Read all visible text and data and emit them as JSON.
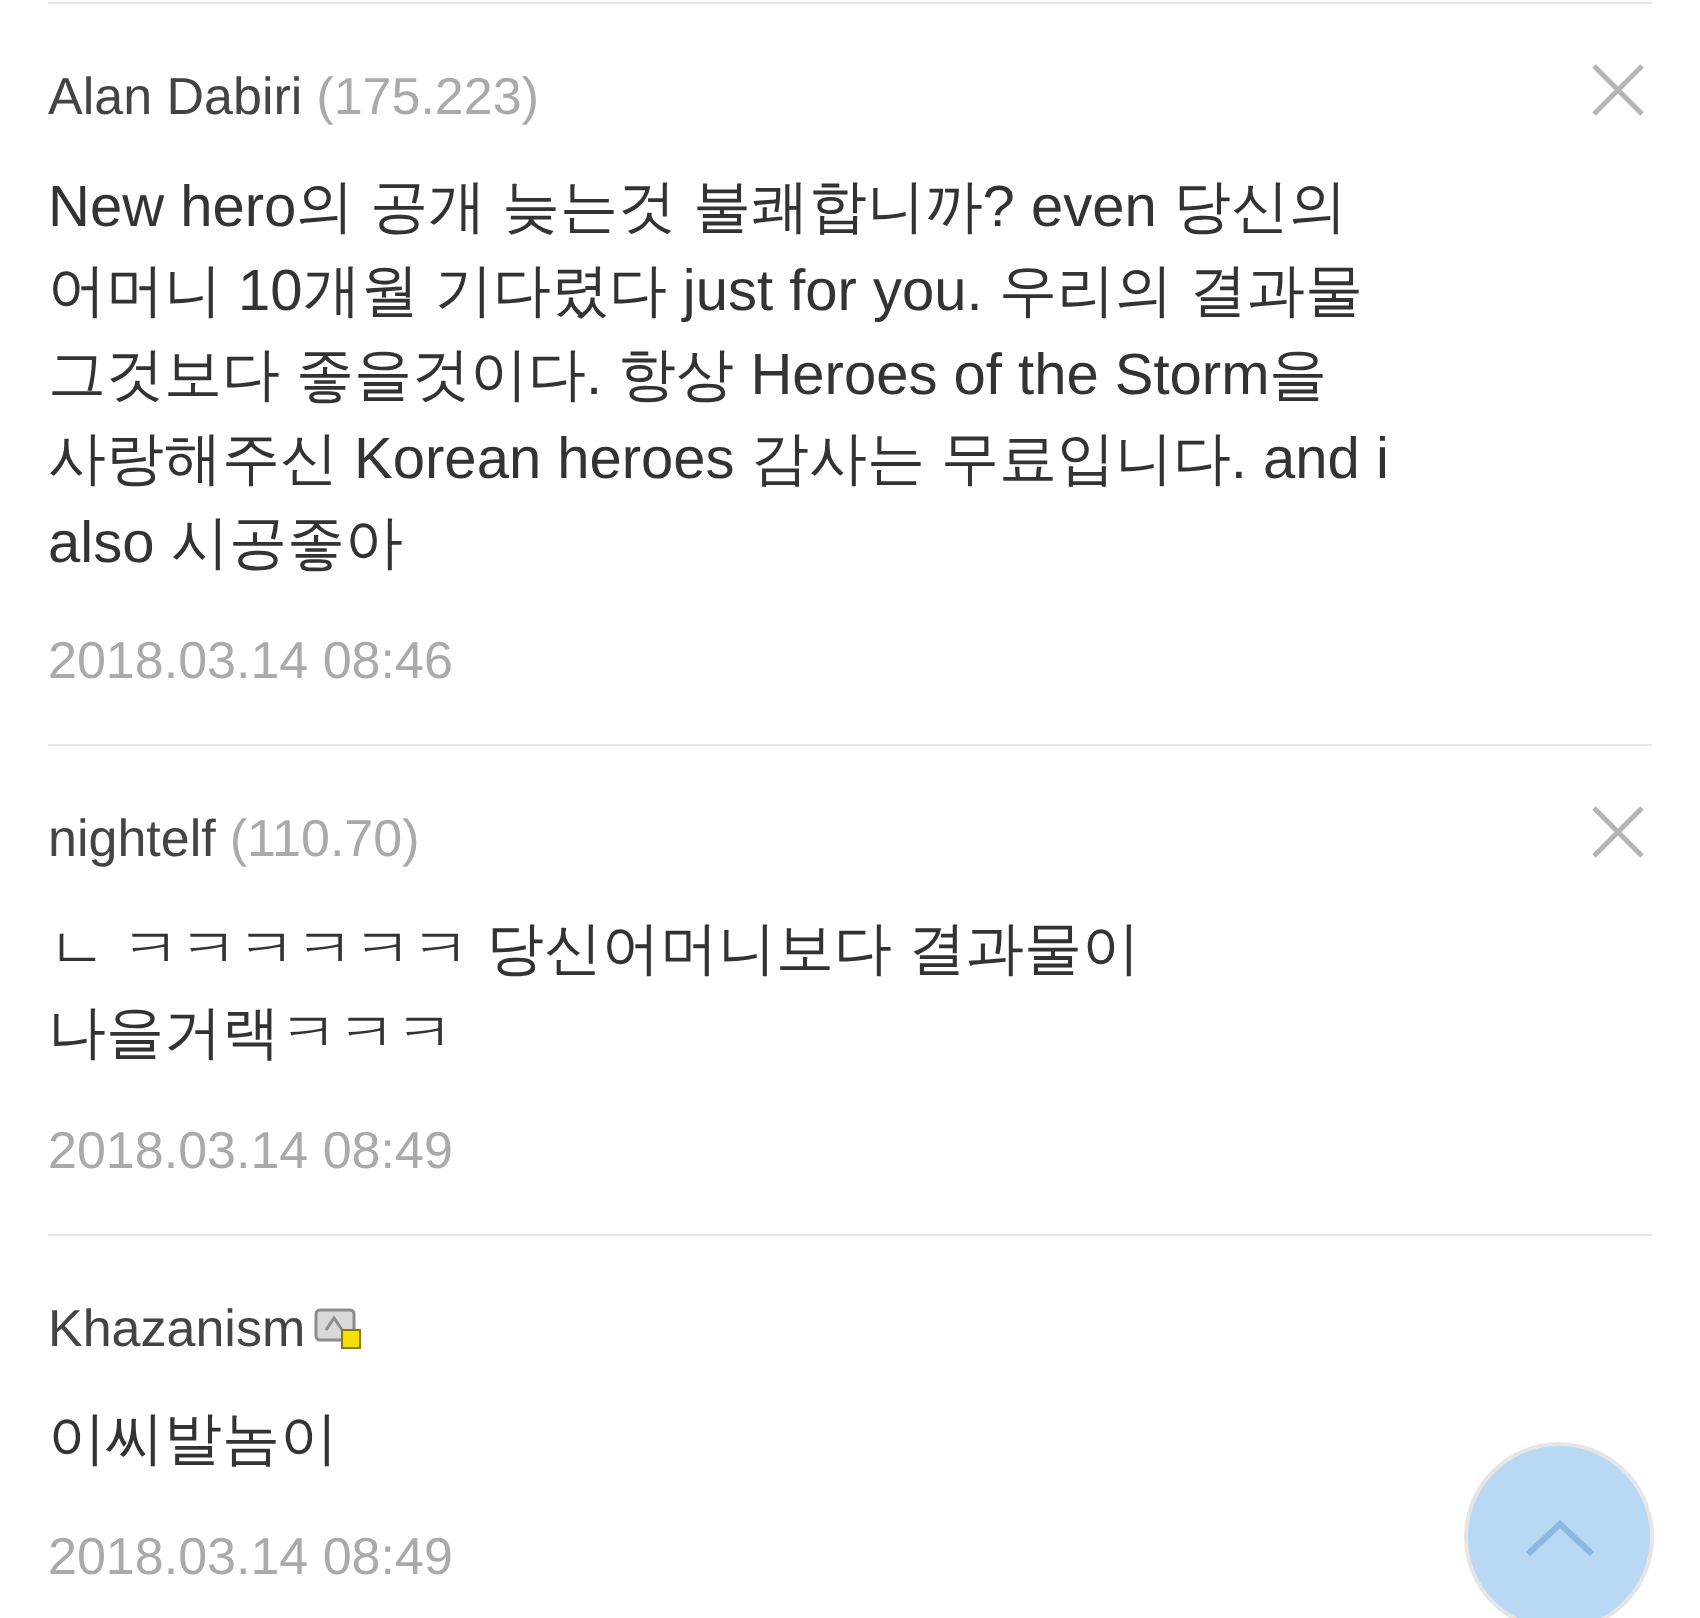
{
  "comments": [
    {
      "kind": "guest",
      "author": "Alan Dabiri",
      "ip": "(175.223)",
      "body": "New hero의 공개 늦는것 불쾌합니까? even 당신의\n어머니 10개월 기다렸다 just for you. 우리의 결과물\n그것보다 좋을것이다. 항상 Heroes of the Storm을\n사랑해주신 Korean heroes 감사는 무료입니다. and i\nalso 시공좋아",
      "date": "2018.03.14 08:46"
    },
    {
      "kind": "guest",
      "author": "nightelf",
      "ip": "(110.70)",
      "body": "ㄴ ㅋㅋㅋㅋㅋㅋ 당신어머니보다 결과물이\n나을거랙ㅋㅋㅋ",
      "date": "2018.03.14 08:49"
    },
    {
      "kind": "member",
      "author": "Khazanism",
      "body": "이씨발놈이",
      "date": "2018.03.14 08:49"
    }
  ]
}
